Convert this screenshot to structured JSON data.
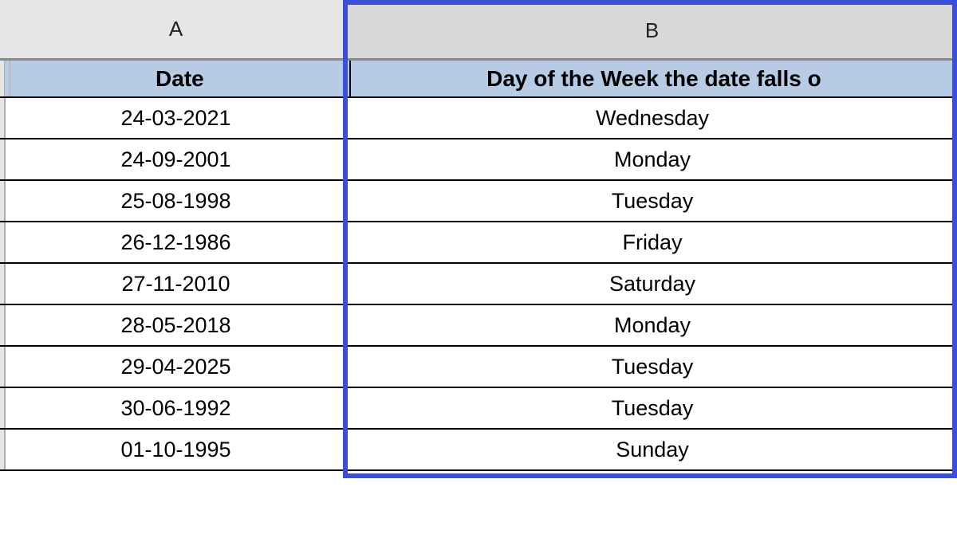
{
  "columns": {
    "a_letter": "A",
    "b_letter": "B"
  },
  "headers": {
    "date": "Date",
    "day": "Day of the Week the date falls o"
  },
  "rows": [
    {
      "date": "24-03-2021",
      "day": "Wednesday"
    },
    {
      "date": "24-09-2001",
      "day": "Monday"
    },
    {
      "date": "25-08-1998",
      "day": "Tuesday"
    },
    {
      "date": "26-12-1986",
      "day": "Friday"
    },
    {
      "date": "27-11-2010",
      "day": "Saturday"
    },
    {
      "date": "28-05-2018",
      "day": "Monday"
    },
    {
      "date": "29-04-2025",
      "day": "Tuesday"
    },
    {
      "date": "30-06-1992",
      "day": "Tuesday"
    },
    {
      "date": "01-10-1995",
      "day": "Sunday"
    }
  ]
}
